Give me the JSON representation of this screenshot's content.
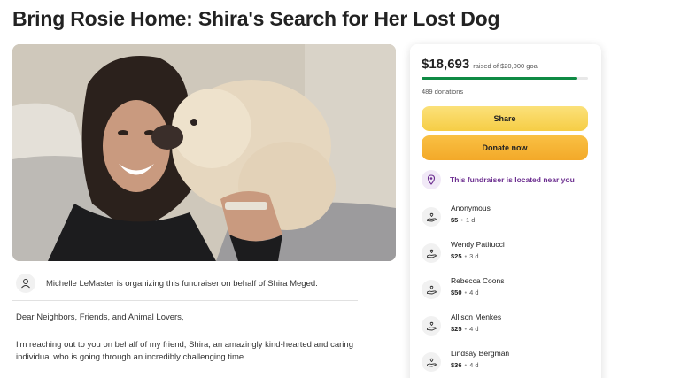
{
  "page": {
    "title": "Bring Rosie Home: Shira's Search for Her Lost Dog"
  },
  "organizer": {
    "text": "Michelle LeMaster is organizing this fundraiser on behalf of Shira Meged."
  },
  "story": {
    "greeting": "Dear Neighbors, Friends, and Animal Lovers,",
    "paragraph": "I'm reaching out to you on behalf of my friend, Shira, an amazingly kind-hearted and caring individual who is going through an incredibly challenging time."
  },
  "donation_card": {
    "raised_amount": "$18,693",
    "goal_text": "raised of $20,000 goal",
    "progress_fraction": 0.935,
    "donations_count": "489 donations",
    "share_label": "Share",
    "donate_label": "Donate now",
    "nearby_text": "This fundraiser is located near you",
    "colors": {
      "progress": "#0f8a44",
      "share": "#f6cd45",
      "donate": "#f3a929",
      "nearby": "#6b2d8f"
    }
  },
  "donors": [
    {
      "name": "Anonymous",
      "amount": "$5",
      "time": "1 d"
    },
    {
      "name": "Wendy Patitucci",
      "amount": "$25",
      "time": "3 d"
    },
    {
      "name": "Rebecca Coons",
      "amount": "$50",
      "time": "4 d"
    },
    {
      "name": "Allison Menkes",
      "amount": "$25",
      "time": "4 d"
    },
    {
      "name": "Lindsay Bergman",
      "amount": "$36",
      "time": "4 d"
    }
  ]
}
